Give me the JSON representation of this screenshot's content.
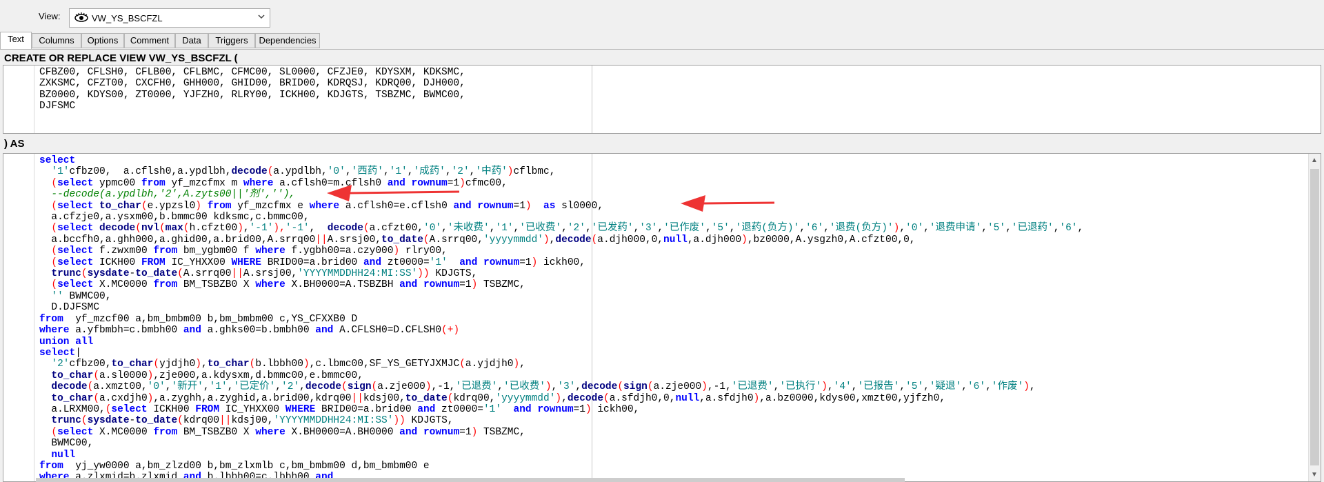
{
  "view_bar": {
    "label": "View:",
    "selected_view": "VW_YS_BSCFZL"
  },
  "tabs": [
    {
      "label": "Text",
      "active": true
    },
    {
      "label": "Columns",
      "active": false
    },
    {
      "label": "Options",
      "active": false
    },
    {
      "label": "Comment",
      "active": false
    },
    {
      "label": "Data",
      "active": false
    },
    {
      "label": "Triggers",
      "active": false
    },
    {
      "label": "Dependencies",
      "active": false
    }
  ],
  "create_header": "CREATE OR REPLACE VIEW VW_YS_BSCFZL (",
  "columns_text": [
    "CFBZ00, CFLSH0, CFLB00, CFLBMC, CFMC00, SL0000, CFZJE0, KDYSXM, KDKSMC,",
    "ZXKSMC, CFZT00, CXCFH0, GHH000, GHID00, BRID00, KDRQSJ, KDRQ00, DJH000,",
    "BZ0000, KDYS00, ZT0000, YJFZH0, RLRY00, ICKH00, KDJGTS, TSBZMC, BWMC00,",
    "DJFSMC"
  ],
  "as_header": ") AS",
  "sql_lines": [
    [
      [
        "k",
        "select"
      ]
    ],
    [
      [
        "n",
        "  "
      ],
      [
        "s",
        "'1'"
      ],
      [
        "n",
        "cfbz00,  a.cflsh0,a.ypdlbh,"
      ],
      [
        "f",
        "decode"
      ],
      [
        "p",
        "("
      ],
      [
        "n",
        "a.ypdlbh,"
      ],
      [
        "s",
        "'0'"
      ],
      [
        "n",
        ","
      ],
      [
        "s",
        "'西药'"
      ],
      [
        "n",
        ","
      ],
      [
        "s",
        "'1'"
      ],
      [
        "n",
        ","
      ],
      [
        "s",
        "'成药'"
      ],
      [
        "n",
        ","
      ],
      [
        "s",
        "'2'"
      ],
      [
        "n",
        ","
      ],
      [
        "s",
        "'中药'"
      ],
      [
        "p",
        ")"
      ],
      [
        "n",
        "cflbmc,"
      ]
    ],
    [
      [
        "n",
        "  "
      ],
      [
        "p",
        "("
      ],
      [
        "k",
        "select"
      ],
      [
        "n",
        " ypmc00 "
      ],
      [
        "k",
        "from"
      ],
      [
        "n",
        " yf_mzcfmx m "
      ],
      [
        "k",
        "where"
      ],
      [
        "n",
        " a.cflsh0=m.cflsh0 "
      ],
      [
        "k",
        "and"
      ],
      [
        "n",
        " "
      ],
      [
        "k",
        "rownum"
      ],
      [
        "n",
        "=1"
      ],
      [
        "p",
        ")"
      ],
      [
        "n",
        "cfmc00,"
      ]
    ],
    [
      [
        "c",
        "  --decode(a.ypdlbh,'2',A.zyts00||'剂',''),"
      ]
    ],
    [
      [
        "n",
        "  "
      ],
      [
        "p",
        "("
      ],
      [
        "k",
        "select"
      ],
      [
        "n",
        " "
      ],
      [
        "f",
        "to_char"
      ],
      [
        "p",
        "("
      ],
      [
        "n",
        "e.ypzsl0"
      ],
      [
        "p",
        ")"
      ],
      [
        "n",
        " "
      ],
      [
        "k",
        "from"
      ],
      [
        "n",
        " yf_mzcfmx e "
      ],
      [
        "k",
        "where"
      ],
      [
        "n",
        " a.cflsh0=e.cflsh0 "
      ],
      [
        "k",
        "and"
      ],
      [
        "n",
        " "
      ],
      [
        "k",
        "rownum"
      ],
      [
        "n",
        "=1"
      ],
      [
        "p",
        ")"
      ],
      [
        "n",
        "  "
      ],
      [
        "k",
        "as"
      ],
      [
        "n",
        " sl0000,"
      ]
    ],
    [
      [
        "n",
        "  a.cfzje0,a.ysxm00,b.bmmc00 kdksmc,c.bmmc00,"
      ]
    ],
    [
      [
        "n",
        "  "
      ],
      [
        "p",
        "("
      ],
      [
        "k",
        "select"
      ],
      [
        "n",
        " "
      ],
      [
        "f",
        "decode"
      ],
      [
        "p",
        "("
      ],
      [
        "f",
        "nvl"
      ],
      [
        "p",
        "("
      ],
      [
        "f",
        "max"
      ],
      [
        "p",
        "("
      ],
      [
        "n",
        "h.cfzt00"
      ],
      [
        "p",
        ")"
      ],
      [
        "n",
        ","
      ],
      [
        "s",
        "'-1'"
      ],
      [
        "p",
        "),"
      ],
      [
        "s",
        "'-1'"
      ],
      [
        "n",
        ",  "
      ],
      [
        "f",
        "decode"
      ],
      [
        "p",
        "("
      ],
      [
        "n",
        "a.cfzt00,"
      ],
      [
        "s",
        "'0'"
      ],
      [
        "n",
        ","
      ],
      [
        "s",
        "'未收费'"
      ],
      [
        "n",
        ","
      ],
      [
        "s",
        "'1'"
      ],
      [
        "n",
        ","
      ],
      [
        "s",
        "'已收费'"
      ],
      [
        "n",
        ","
      ],
      [
        "s",
        "'2'"
      ],
      [
        "n",
        ","
      ],
      [
        "s",
        "'已发药'"
      ],
      [
        "n",
        ","
      ],
      [
        "s",
        "'3'"
      ],
      [
        "n",
        ","
      ],
      [
        "s",
        "'已作废'"
      ],
      [
        "n",
        ","
      ],
      [
        "s",
        "'5'"
      ],
      [
        "n",
        ","
      ],
      [
        "s",
        "'退药(负方)'"
      ],
      [
        "n",
        ","
      ],
      [
        "s",
        "'6'"
      ],
      [
        "n",
        ","
      ],
      [
        "s",
        "'退费(负方)'"
      ],
      [
        "p",
        ")"
      ],
      [
        "n",
        ","
      ],
      [
        "s",
        "'0'"
      ],
      [
        "n",
        ","
      ],
      [
        "s",
        "'退费申请'"
      ],
      [
        "n",
        ","
      ],
      [
        "s",
        "'5'"
      ],
      [
        "n",
        ","
      ],
      [
        "s",
        "'已退药'"
      ],
      [
        "n",
        ","
      ],
      [
        "s",
        "'6'"
      ],
      [
        "n",
        ","
      ]
    ],
    [
      [
        "n",
        "  a.bccfh0,a.ghh000,a.ghid00,a.brid00,A.srrq00"
      ],
      [
        "p",
        "||"
      ],
      [
        "n",
        "A.srsj00,"
      ],
      [
        "f",
        "to_date"
      ],
      [
        "p",
        "("
      ],
      [
        "n",
        "A.srrq00,"
      ],
      [
        "s",
        "'yyyymmdd'"
      ],
      [
        "p",
        ")"
      ],
      [
        "n",
        ","
      ],
      [
        "f",
        "decode"
      ],
      [
        "p",
        "("
      ],
      [
        "n",
        "a.djh000,0,"
      ],
      [
        "k",
        "null"
      ],
      [
        "n",
        ",a.djh000"
      ],
      [
        "p",
        ")"
      ],
      [
        "n",
        ",bz0000,A.ysgzh0,A.cfzt00,0,"
      ]
    ],
    [
      [
        "n",
        "  "
      ],
      [
        "p",
        "("
      ],
      [
        "k",
        "select"
      ],
      [
        "n",
        " f.zwxm00 "
      ],
      [
        "k",
        "from"
      ],
      [
        "n",
        " bm_ygbm00 f "
      ],
      [
        "k",
        "where"
      ],
      [
        "n",
        " f.ygbh00=a.czy000"
      ],
      [
        "p",
        ")"
      ],
      [
        "n",
        " rlry00,"
      ]
    ],
    [
      [
        "n",
        "  "
      ],
      [
        "p",
        "("
      ],
      [
        "k",
        "select"
      ],
      [
        "n",
        " ICKH00 "
      ],
      [
        "k",
        "FROM"
      ],
      [
        "n",
        " IC_YHXX00 "
      ],
      [
        "k",
        "WHERE"
      ],
      [
        "n",
        " BRID00=a.brid00 "
      ],
      [
        "k",
        "and"
      ],
      [
        "n",
        " zt0000="
      ],
      [
        "s",
        "'1'"
      ],
      [
        "n",
        "  "
      ],
      [
        "k",
        "and"
      ],
      [
        "n",
        " "
      ],
      [
        "k",
        "rownum"
      ],
      [
        "n",
        "=1"
      ],
      [
        "p",
        ")"
      ],
      [
        "n",
        " ickh00,"
      ]
    ],
    [
      [
        "n",
        "  "
      ],
      [
        "f",
        "trunc"
      ],
      [
        "p",
        "("
      ],
      [
        "f",
        "sysdate"
      ],
      [
        "n",
        "-"
      ],
      [
        "f",
        "to_date"
      ],
      [
        "p",
        "("
      ],
      [
        "n",
        "A.srrq00"
      ],
      [
        "p",
        "||"
      ],
      [
        "n",
        "A.srsj00,"
      ],
      [
        "s",
        "'YYYYMMDDHH24:MI:SS'"
      ],
      [
        "p",
        "))"
      ],
      [
        "n",
        " KDJGTS,"
      ]
    ],
    [
      [
        "n",
        "  "
      ],
      [
        "p",
        "("
      ],
      [
        "k",
        "select"
      ],
      [
        "n",
        " X.MC0000 "
      ],
      [
        "k",
        "from"
      ],
      [
        "n",
        " BM_TSBZB0 X "
      ],
      [
        "k",
        "where"
      ],
      [
        "n",
        " X.BH0000=A.TSBZBH "
      ],
      [
        "k",
        "and"
      ],
      [
        "n",
        " "
      ],
      [
        "k",
        "rownum"
      ],
      [
        "n",
        "=1"
      ],
      [
        "p",
        ")"
      ],
      [
        "n",
        " TSBZMC,"
      ]
    ],
    [
      [
        "n",
        "  "
      ],
      [
        "s",
        "''"
      ],
      [
        "n",
        " BWMC00,"
      ]
    ],
    [
      [
        "n",
        "  D.DJFSMC"
      ]
    ],
    [
      [
        "k",
        "from"
      ],
      [
        "n",
        "  yf_mzcf00 a,bm_bmbm00 b,bm_bmbm00 c,YS_CFXXB0 D"
      ]
    ],
    [
      [
        "k",
        "where"
      ],
      [
        "n",
        " a.yfbmbh=c.bmbh00 "
      ],
      [
        "k",
        "and"
      ],
      [
        "n",
        " a.ghks00=b.bmbh00 "
      ],
      [
        "k",
        "and"
      ],
      [
        "n",
        " A.CFLSH0=D.CFLSH0"
      ],
      [
        "p",
        "(+)"
      ]
    ],
    [
      [
        "k",
        "union all"
      ]
    ],
    [
      [
        "k",
        "select"
      ],
      [
        "n",
        "|"
      ]
    ],
    [
      [
        "n",
        "  "
      ],
      [
        "s",
        "'2'"
      ],
      [
        "n",
        "cfbz00,"
      ],
      [
        "f",
        "to_char"
      ],
      [
        "p",
        "("
      ],
      [
        "n",
        "yjdjh0"
      ],
      [
        "p",
        ")"
      ],
      [
        "n",
        ","
      ],
      [
        "f",
        "to_char"
      ],
      [
        "p",
        "("
      ],
      [
        "n",
        "b.lbbh00"
      ],
      [
        "p",
        ")"
      ],
      [
        "n",
        ",c.lbmc00,SF_YS_GETYJXMJC"
      ],
      [
        "p",
        "("
      ],
      [
        "n",
        "a.yjdjh0"
      ],
      [
        "p",
        ")"
      ],
      [
        "n",
        ","
      ]
    ],
    [
      [
        "n",
        "  "
      ],
      [
        "f",
        "to_char"
      ],
      [
        "p",
        "("
      ],
      [
        "n",
        "a.sl0000"
      ],
      [
        "p",
        ")"
      ],
      [
        "n",
        ",zje000,a.kdysxm,d.bmmc00,e.bmmc00,"
      ]
    ],
    [
      [
        "n",
        "  "
      ],
      [
        "f",
        "decode"
      ],
      [
        "p",
        "("
      ],
      [
        "n",
        "a.xmzt00,"
      ],
      [
        "s",
        "'0'"
      ],
      [
        "n",
        ","
      ],
      [
        "s",
        "'新开'"
      ],
      [
        "n",
        ","
      ],
      [
        "s",
        "'1'"
      ],
      [
        "n",
        ","
      ],
      [
        "s",
        "'已定价'"
      ],
      [
        "n",
        ","
      ],
      [
        "s",
        "'2'"
      ],
      [
        "n",
        ","
      ],
      [
        "f",
        "decode"
      ],
      [
        "p",
        "("
      ],
      [
        "f",
        "sign"
      ],
      [
        "p",
        "("
      ],
      [
        "n",
        "a.zje000"
      ],
      [
        "p",
        ")"
      ],
      [
        "n",
        ",-1,"
      ],
      [
        "s",
        "'已退费'"
      ],
      [
        "n",
        ","
      ],
      [
        "s",
        "'已收费'"
      ],
      [
        "p",
        ")"
      ],
      [
        "n",
        ","
      ],
      [
        "s",
        "'3'"
      ],
      [
        "n",
        ","
      ],
      [
        "f",
        "decode"
      ],
      [
        "p",
        "("
      ],
      [
        "f",
        "sign"
      ],
      [
        "p",
        "("
      ],
      [
        "n",
        "a.zje000"
      ],
      [
        "p",
        ")"
      ],
      [
        "n",
        ",-1,"
      ],
      [
        "s",
        "'已退费'"
      ],
      [
        "n",
        ","
      ],
      [
        "s",
        "'已执行'"
      ],
      [
        "p",
        ")"
      ],
      [
        "n",
        ","
      ],
      [
        "s",
        "'4'"
      ],
      [
        "n",
        ","
      ],
      [
        "s",
        "'已报告'"
      ],
      [
        "n",
        ","
      ],
      [
        "s",
        "'5'"
      ],
      [
        "n",
        ","
      ],
      [
        "s",
        "'疑退'"
      ],
      [
        "n",
        ","
      ],
      [
        "s",
        "'6'"
      ],
      [
        "n",
        ","
      ],
      [
        "s",
        "'作废'"
      ],
      [
        "p",
        ")"
      ],
      [
        "n",
        ","
      ]
    ],
    [
      [
        "n",
        "  "
      ],
      [
        "f",
        "to_char"
      ],
      [
        "p",
        "("
      ],
      [
        "n",
        "a.cxdjh0"
      ],
      [
        "p",
        ")"
      ],
      [
        "n",
        ",a.zyghh,a.zyghid,a.brid00,kdrq00"
      ],
      [
        "p",
        "||"
      ],
      [
        "n",
        "kdsj00,"
      ],
      [
        "f",
        "to_date"
      ],
      [
        "p",
        "("
      ],
      [
        "n",
        "kdrq00,"
      ],
      [
        "s",
        "'yyyymmdd'"
      ],
      [
        "p",
        ")"
      ],
      [
        "n",
        ","
      ],
      [
        "f",
        "decode"
      ],
      [
        "p",
        "("
      ],
      [
        "n",
        "a.sfdjh0,0,"
      ],
      [
        "k",
        "null"
      ],
      [
        "n",
        ",a.sfdjh0"
      ],
      [
        "p",
        ")"
      ],
      [
        "n",
        ",a.bz0000,kdys00,xmzt00,yjfzh0,"
      ]
    ],
    [
      [
        "n",
        "  a.LRXM00,"
      ],
      [
        "p",
        "("
      ],
      [
        "k",
        "select"
      ],
      [
        "n",
        " ICKH00 "
      ],
      [
        "k",
        "FROM"
      ],
      [
        "n",
        " IC_YHXX00 "
      ],
      [
        "k",
        "WHERE"
      ],
      [
        "n",
        " BRID00=a.brid00 "
      ],
      [
        "k",
        "and"
      ],
      [
        "n",
        " zt0000="
      ],
      [
        "s",
        "'1'"
      ],
      [
        "n",
        "  "
      ],
      [
        "k",
        "and"
      ],
      [
        "n",
        " "
      ],
      [
        "k",
        "rownum"
      ],
      [
        "n",
        "=1"
      ],
      [
        "p",
        ")"
      ],
      [
        "n",
        " ickh00,"
      ]
    ],
    [
      [
        "n",
        "  "
      ],
      [
        "f",
        "trunc"
      ],
      [
        "p",
        "("
      ],
      [
        "f",
        "sysdate"
      ],
      [
        "n",
        "-"
      ],
      [
        "f",
        "to_date"
      ],
      [
        "p",
        "("
      ],
      [
        "n",
        "kdrq00"
      ],
      [
        "p",
        "||"
      ],
      [
        "n",
        "kdsj00,"
      ],
      [
        "s",
        "'YYYYMMDDHH24:MI:SS'"
      ],
      [
        "p",
        "))"
      ],
      [
        "n",
        " KDJGTS,"
      ]
    ],
    [
      [
        "n",
        "  "
      ],
      [
        "p",
        "("
      ],
      [
        "k",
        "select"
      ],
      [
        "n",
        " X.MC0000 "
      ],
      [
        "k",
        "from"
      ],
      [
        "n",
        " BM_TSBZB0 X "
      ],
      [
        "k",
        "where"
      ],
      [
        "n",
        " X.BH0000=A.BH0000 "
      ],
      [
        "k",
        "and"
      ],
      [
        "n",
        " "
      ],
      [
        "k",
        "rownum"
      ],
      [
        "n",
        "=1"
      ],
      [
        "p",
        ")"
      ],
      [
        "n",
        " TSBZMC,"
      ]
    ],
    [
      [
        "n",
        "  BWMC00,"
      ]
    ],
    [
      [
        "n",
        "  "
      ],
      [
        "k",
        "null"
      ]
    ],
    [
      [
        "k",
        "from"
      ],
      [
        "n",
        "  yj_yw0000 a,bm_zlzd00 b,bm_zlxmlb c,bm_bmbm00 d,bm_bmbm00 e"
      ]
    ],
    [
      [
        "k",
        "where"
      ],
      [
        "n",
        " a.zlxmid=b.zlxmid "
      ],
      [
        "k",
        "and"
      ],
      [
        "n",
        " b.lbbh00=c.lbbh00 "
      ],
      [
        "k",
        "and"
      ]
    ]
  ],
  "colors": {
    "keyword": "#0000ff",
    "function": "#000080",
    "string": "#008080",
    "comment": "#008000",
    "operator": "#ff0000",
    "annotation_arrow": "#ee3333"
  },
  "icons": {
    "view_icon": "eye-icon",
    "dropdown": "chevron-down-icon",
    "scroll_up": "arrow-up-icon",
    "scroll_down": "arrow-down-icon"
  }
}
